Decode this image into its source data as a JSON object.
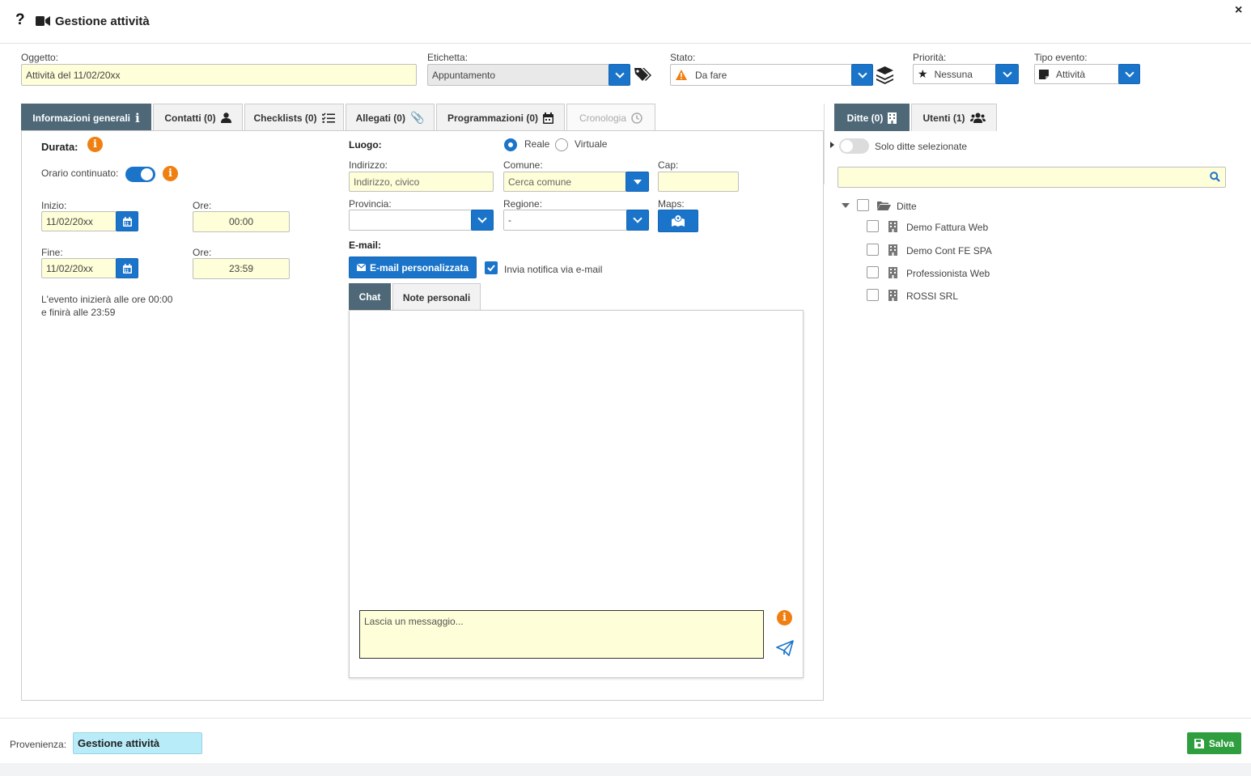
{
  "window": {
    "title": "Gestione attività"
  },
  "fields": {
    "oggetto_label": "Oggetto:",
    "oggetto_value": "Attività del 11/02/20xx",
    "etichetta_label": "Etichetta:",
    "etichetta_value": "Appuntamento",
    "stato_label": "Stato:",
    "stato_value": "Da fare",
    "priorita_label": "Priorità:",
    "priorita_value": "Nessuna",
    "tipo_label": "Tipo evento:",
    "tipo_value": "Attività"
  },
  "tabs": [
    {
      "label": "Informazioni generali"
    },
    {
      "label": "Contatti (0)"
    },
    {
      "label": "Checklists (0)"
    },
    {
      "label": "Allegati (0)"
    },
    {
      "label": "Programmazioni (0)"
    },
    {
      "label": "Cronologia"
    }
  ],
  "general": {
    "durata_label": "Durata:",
    "orario_label": "Orario continuato:",
    "inizio_label": "Inizio:",
    "inizio_value": "11/02/20xx",
    "ore_label": "Ore:",
    "ore_inizio": "00:00",
    "fine_label": "Fine:",
    "fine_value": "11/02/20xx",
    "ore_fine": "23:59",
    "summary_line1": "L'evento inizierà alle ore 00:00",
    "summary_line2": "e finirà alle 23:59"
  },
  "luogo": {
    "label": "Luogo:",
    "reale": "Reale",
    "virtuale": "Virtuale",
    "indirizzo_label": "Indirizzo:",
    "indirizzo_placeholder": "Indirizzo, civico",
    "comune_label": "Comune:",
    "comune_placeholder": "Cerca comune",
    "cap_label": "Cap:",
    "provincia_label": "Provincia:",
    "regione_label": "Regione:",
    "regione_value": "-",
    "maps_label": "Maps:"
  },
  "email": {
    "label": "E-mail:",
    "button": "E-mail personalizzata",
    "notify": "Invia notifica via e-mail"
  },
  "chat": {
    "tabs": [
      {
        "label": "Chat"
      },
      {
        "label": "Note personali"
      }
    ],
    "placeholder": "Lascia un messaggio..."
  },
  "right": {
    "tabs": [
      {
        "label": "Ditte (0)"
      },
      {
        "label": "Utenti (1)"
      }
    ],
    "toggle_label": "Solo ditte selezionate",
    "tree_root": "Ditte",
    "items": [
      {
        "label": "Demo Fattura Web"
      },
      {
        "label": "Demo Cont FE SPA"
      },
      {
        "label": "Professionista Web"
      },
      {
        "label": "ROSSI SRL"
      }
    ]
  },
  "footer": {
    "provenienza_label": "Provenienza:",
    "provenienza_value": "Gestione attività",
    "save": "Salva"
  },
  "colors": {
    "accent": "#1a74c9",
    "tab_active": "#4e6878",
    "info": "#f07f12",
    "save": "#2e9e3e",
    "input_bg": "#fefed8"
  }
}
